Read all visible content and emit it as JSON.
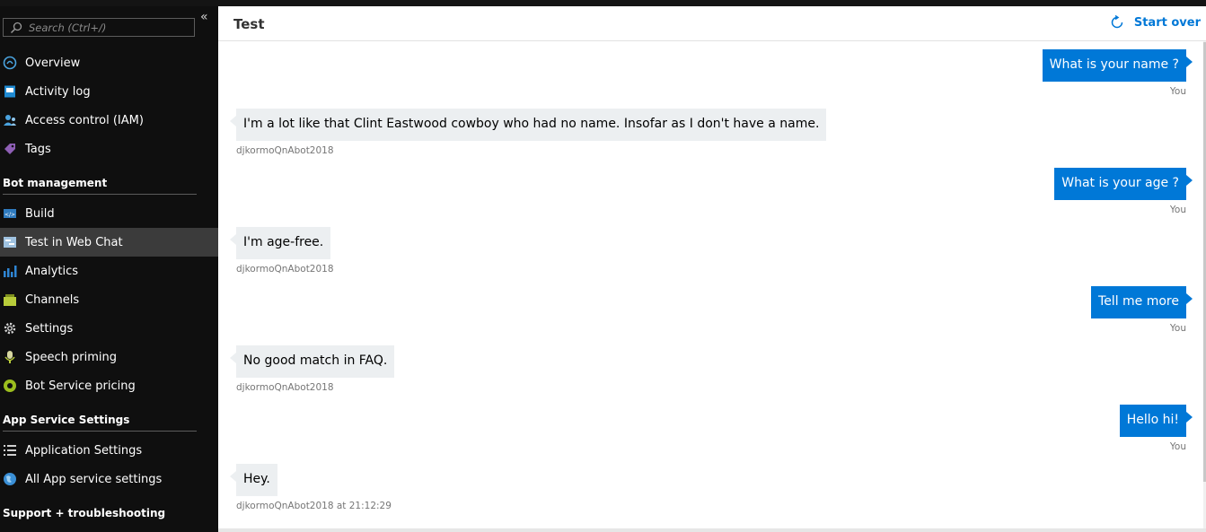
{
  "sidebar": {
    "search_placeholder": "Search (Ctrl+/)",
    "items_top": [
      {
        "label": "Overview",
        "icon": "overview-icon"
      },
      {
        "label": "Activity log",
        "icon": "activity-log-icon"
      },
      {
        "label": "Access control (IAM)",
        "icon": "access-control-icon"
      },
      {
        "label": "Tags",
        "icon": "tag-icon"
      }
    ],
    "sections": [
      {
        "label": "Bot management"
      },
      {
        "label": "App Service Settings"
      },
      {
        "label": "Support + troubleshooting"
      }
    ],
    "items_bot": [
      {
        "label": "Build",
        "icon": "build-icon"
      },
      {
        "label": "Test in Web Chat",
        "icon": "web-chat-icon"
      },
      {
        "label": "Analytics",
        "icon": "analytics-icon"
      },
      {
        "label": "Channels",
        "icon": "channels-icon"
      },
      {
        "label": "Settings",
        "icon": "gear-icon"
      },
      {
        "label": "Speech priming",
        "icon": "speech-priming-icon"
      },
      {
        "label": "Bot Service pricing",
        "icon": "pricing-icon"
      }
    ],
    "items_app": [
      {
        "label": "Application Settings",
        "icon": "list-icon"
      },
      {
        "label": "All App service settings",
        "icon": "globe-icon"
      }
    ]
  },
  "main": {
    "title": "Test",
    "start_over_label": "Start over"
  },
  "messages": [
    {
      "from": "user",
      "text": "What is your name ?",
      "meta": "You"
    },
    {
      "from": "bot",
      "text": "I'm a lot like that Clint Eastwood cowboy who had no name. Insofar as I don't have a name.",
      "meta": "djkormoQnAbot2018"
    },
    {
      "from": "user",
      "text": "What is your age ?",
      "meta": "You"
    },
    {
      "from": "bot",
      "text": "I'm age-free.",
      "meta": "djkormoQnAbot2018"
    },
    {
      "from": "user",
      "text": "Tell me more",
      "meta": "You"
    },
    {
      "from": "bot",
      "text": "No good match in FAQ.",
      "meta": "djkormoQnAbot2018"
    },
    {
      "from": "user",
      "text": "Hello hi!",
      "meta": "You"
    },
    {
      "from": "bot",
      "text": "Hey.",
      "meta": "djkormoQnAbot2018 at 21:12:29"
    }
  ],
  "colors": {
    "accent": "#0078d7",
    "bot_bubble": "#eceff1",
    "sidebar_bg": "#0f0f0f",
    "selected_bg": "#3b3b3b"
  }
}
